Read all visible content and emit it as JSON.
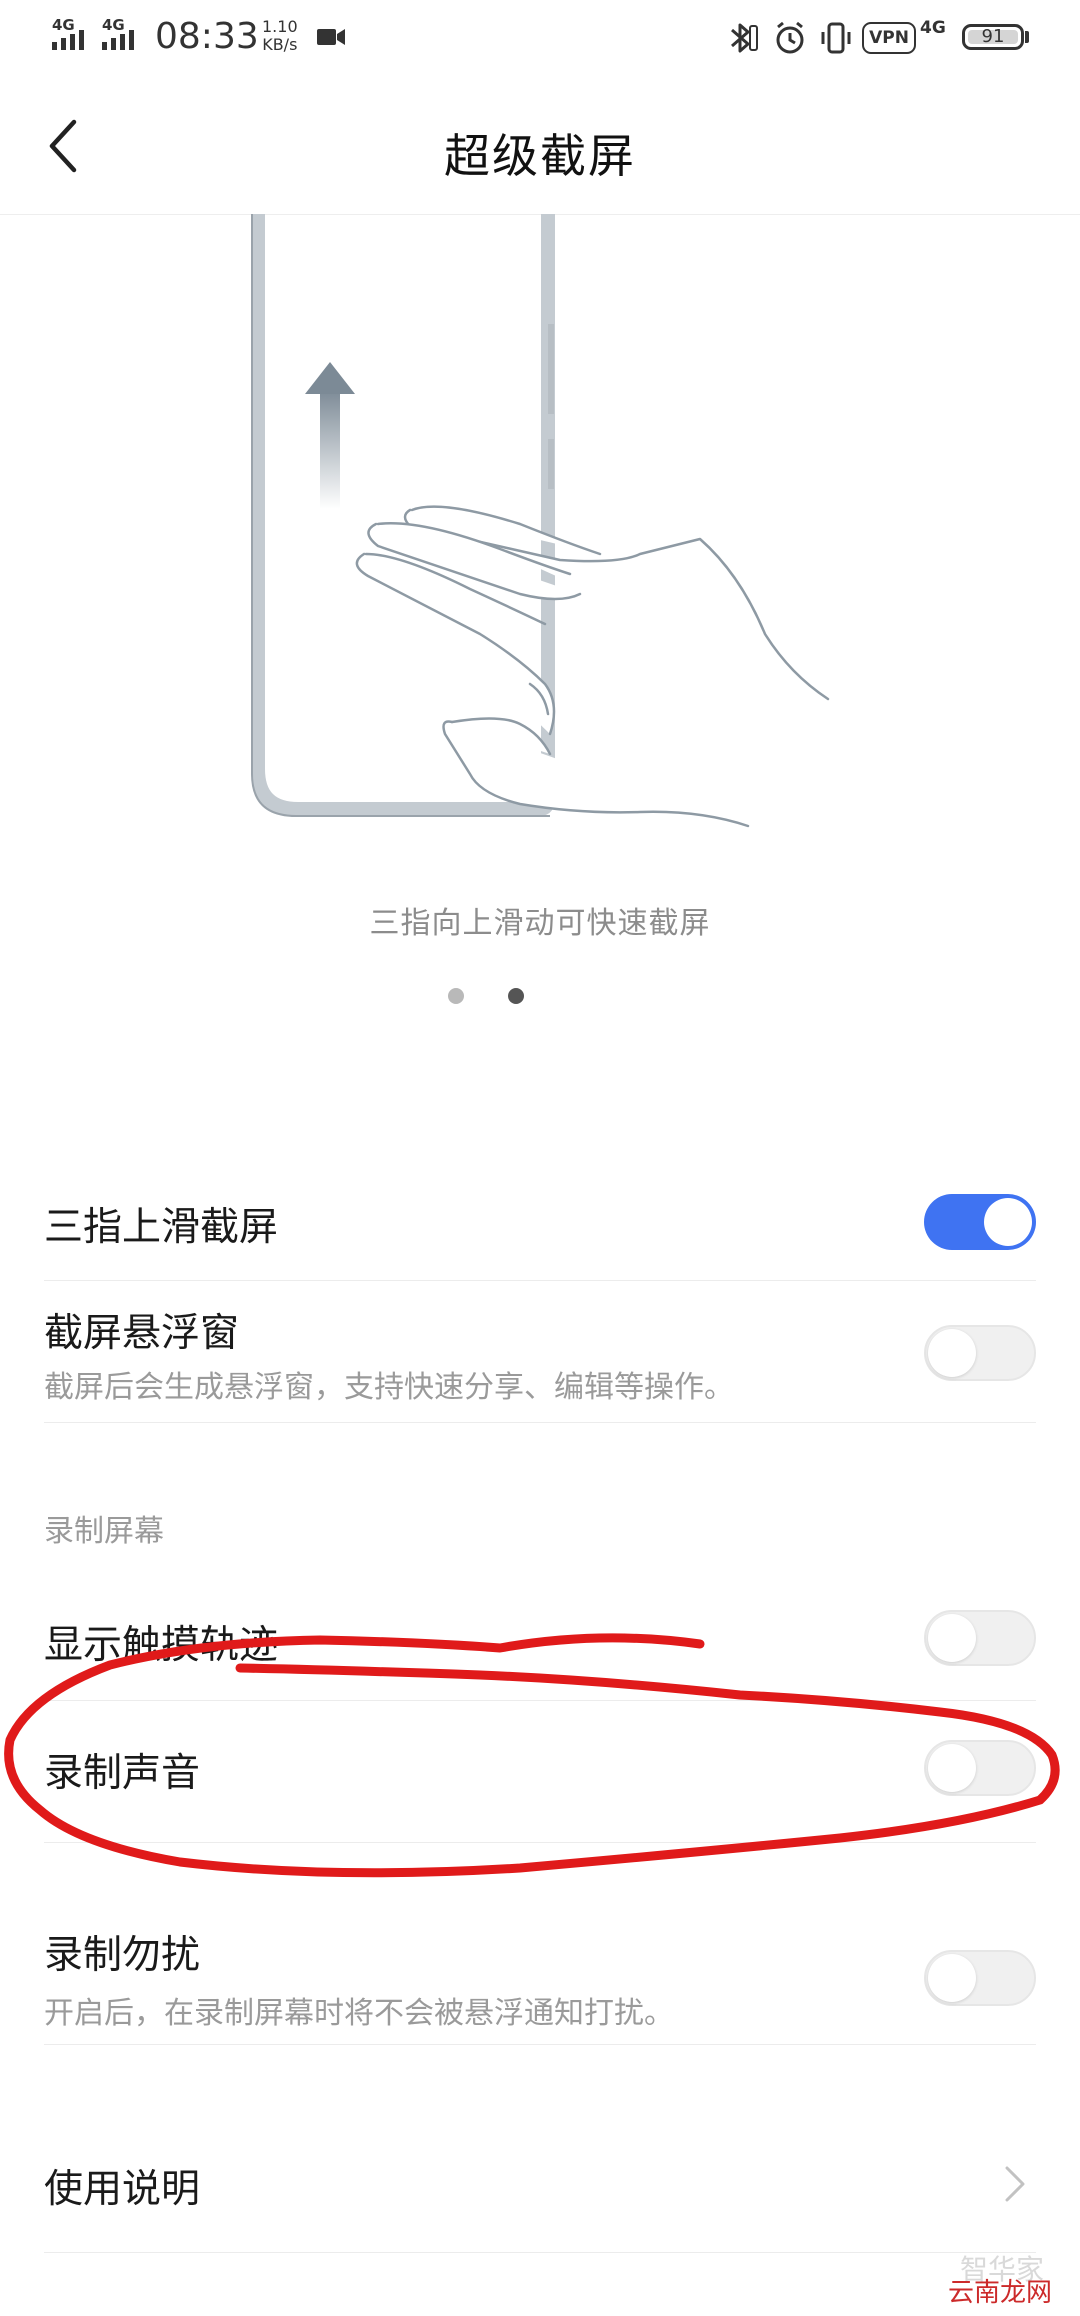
{
  "status_bar": {
    "network_1": "4G",
    "network_2": "4G",
    "time": "08:33",
    "speed_value": "1.10",
    "speed_unit": "KB/s",
    "vpn": "VPN",
    "network_3": "4G",
    "battery": "91",
    "icons": [
      "video-record-icon",
      "bluetooth-icon",
      "alarm-icon",
      "vibrate-icon"
    ]
  },
  "header": {
    "title": "超级截屏",
    "back_icon": "back-arrow-icon"
  },
  "illustration": {
    "caption": "三指向上滑动可快速截屏",
    "pager_count": 2,
    "pager_active": 1
  },
  "settings": {
    "three_finger": {
      "title": "三指上滑截屏",
      "enabled": true
    },
    "float_window": {
      "title": "截屏悬浮窗",
      "subtitle": "截屏后会生成悬浮窗，支持快速分享、编辑等操作。",
      "enabled": false
    },
    "section_record": "录制屏幕",
    "touch_trace": {
      "title": "显示触摸轨迹",
      "enabled": false
    },
    "record_sound": {
      "title": "录制声音",
      "enabled": false
    },
    "record_dnd": {
      "title": "录制勿扰",
      "subtitle": "开启后，在录制屏幕时将不会被悬浮通知打扰。",
      "enabled": false
    },
    "instructions": {
      "title": "使用说明",
      "icon": "chevron-right-icon"
    }
  },
  "watermark": {
    "logo_text": "云南龙网",
    "faint_text": "智华家"
  },
  "colors": {
    "accent": "#3f73f2",
    "annotation": "#e01a1a",
    "caption": "#8c8c8c"
  }
}
